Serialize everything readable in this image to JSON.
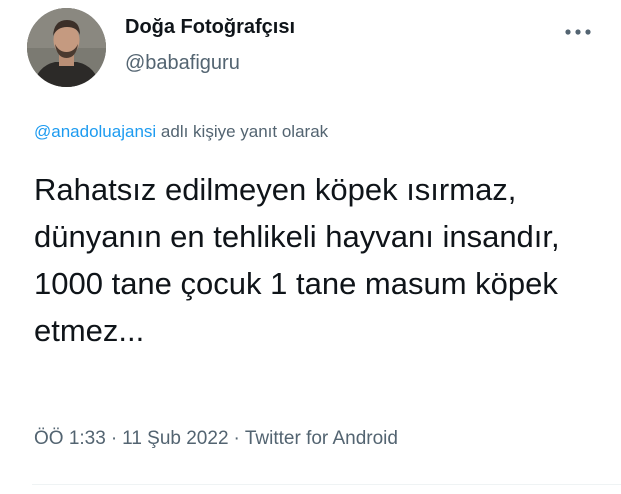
{
  "user": {
    "display_name": "Doğa Fotoğrafçısı",
    "username": "@babafiguru",
    "avatar_icon": "profile-photo"
  },
  "more_icon": "more-horizontal-icon",
  "reply": {
    "mention": "@anadoluajansi",
    "text": " adlı kişiye yanıt olarak"
  },
  "tweet": {
    "text": "Rahatsız edilmeyen köpek ısırmaz, dünyanın en tehlikeli hayvanı insandır, 1000 tane çocuk 1 tane masum köpek etmez..."
  },
  "meta": {
    "time": "ÖÖ 1:33",
    "date": "11 Şub 2022",
    "source": "Twitter for Android",
    "separator": "·"
  },
  "colors": {
    "text": "#0f1419",
    "secondary": "#536471",
    "link": "#1d9bf0"
  }
}
